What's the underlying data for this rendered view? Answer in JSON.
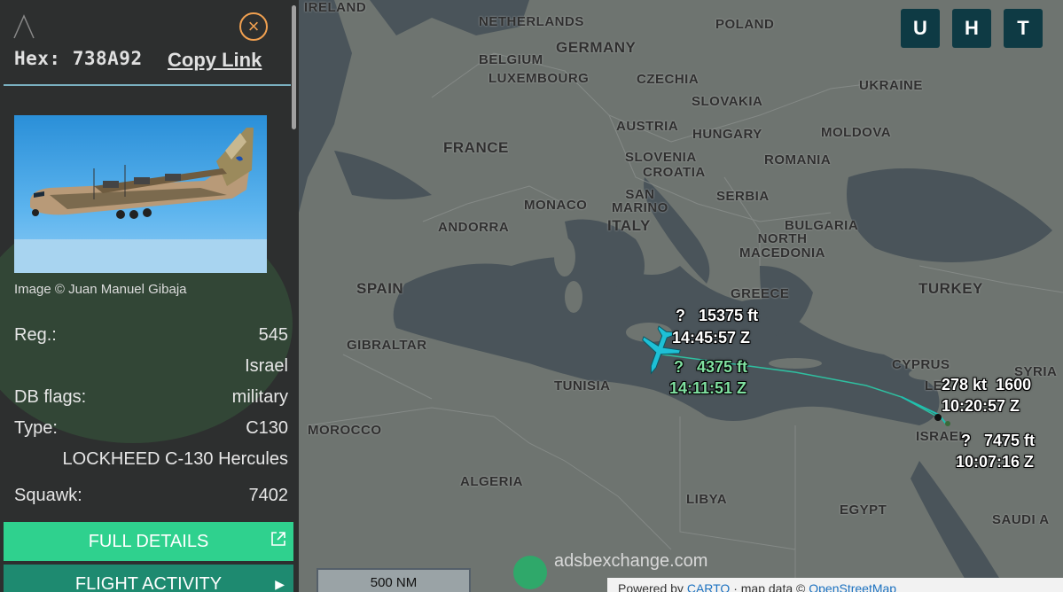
{
  "sidebar": {
    "hex_label": "Hex:",
    "hex_value": "738A92",
    "copy_link": "Copy Link",
    "close_icon": "close-icon",
    "image_credit": "Image © Juan Manuel Gibaja",
    "reg_label": "Reg.:",
    "reg_value": "545",
    "country": "Israel",
    "dbflags_label": "DB flags:",
    "dbflags_value": "military",
    "type_label": "Type:",
    "type_value": "C130",
    "type_name": "LOCKHEED C-130 Hercules",
    "squawk_label": "Squawk:",
    "squawk_value": "7402",
    "full_details": "FULL DETAILS",
    "flight_activity": "FLIGHT ACTIVITY"
  },
  "map": {
    "buttons": [
      "U",
      "H",
      "T"
    ],
    "countries": {
      "ireland": "IRELAND",
      "netherlands": "NETHERLANDS",
      "poland": "POLAND",
      "germany": "GERMANY",
      "belgium": "BELGIUM",
      "luxembourg": "LUXEMBOURG",
      "czechia": "CZECHIA",
      "slovakia": "SLOVAKIA",
      "ukraine": "UKRAINE",
      "austria": "AUSTRIA",
      "hungary": "HUNGARY",
      "moldova": "MOLDOVA",
      "france": "FRANCE",
      "slovenia": "SLOVENIA",
      "croatia": "CROATIA",
      "romania": "ROMANIA",
      "san_marino": "SAN\nMARINO",
      "monaco": "MONACO",
      "serbia": "SERBIA",
      "andorra": "ANDORRA",
      "italy": "ITALY",
      "bulgaria": "BULGARIA",
      "north_macedonia": "NORTH\nMACEDONIA",
      "spain": "SPAIN",
      "greece": "GREECE",
      "turkey": "TURKEY",
      "gibraltar": "GIBRALTAR",
      "tunisia": "TUNISIA",
      "cyprus": "CYPRUS",
      "syria": "SYRIA",
      "lebanon": "LE",
      "israel": "ISRAEL",
      "morocco": "MOROCCO",
      "algeria": "ALGERIA",
      "libya": "LIBYA",
      "egypt": "EGYPT",
      "saudi": "SAUDI A"
    },
    "labels": [
      {
        "q": "?",
        "alt": "15375 ft",
        "time": "14:45:57 Z"
      },
      {
        "q": "?",
        "alt": "4375 ft",
        "time": "14:11:51 Z"
      },
      {
        "speed": "278 kt",
        "alt": "1600",
        "time": "10:20:57 Z"
      },
      {
        "q": "?",
        "alt": "7475 ft",
        "time": "10:07:16 Z"
      }
    ],
    "scale": "500 NM",
    "brand": "adsbexchange.com",
    "attribution_prefix": "Powered by ",
    "attribution_link1": "CARTO",
    "attribution_mid": " · map data © ",
    "attribution_link2": "OpenStreetMap"
  },
  "colors": {
    "accent_green": "#2fd18e",
    "flight_btn": "#1e8a70",
    "close_orange": "#f0a050",
    "aircraft": "#1ec0d6"
  }
}
